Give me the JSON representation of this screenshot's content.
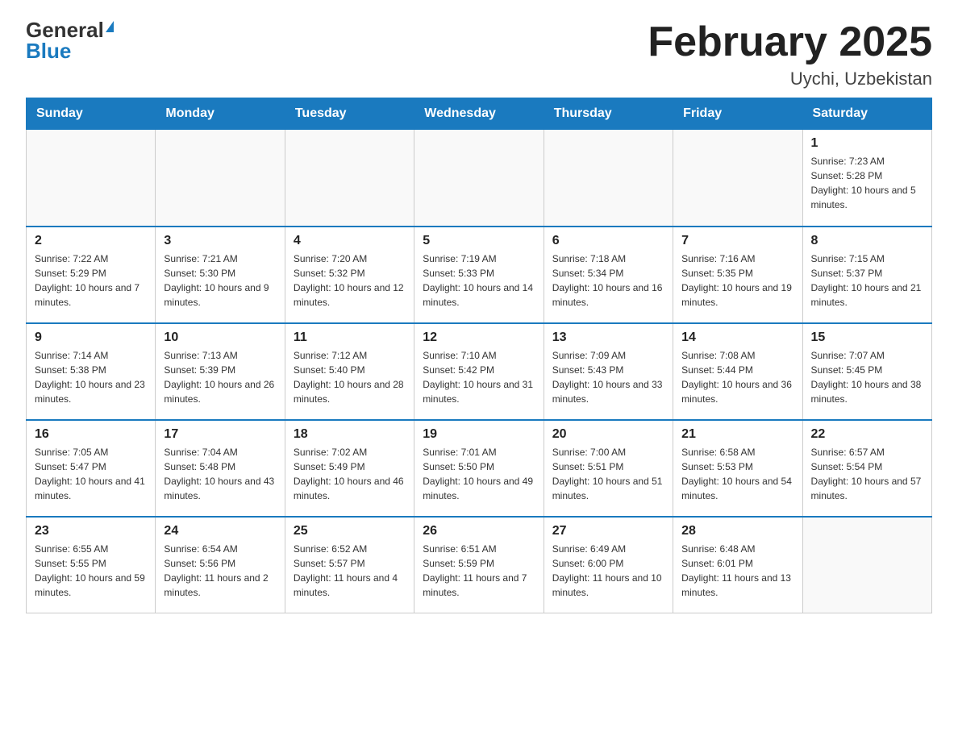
{
  "header": {
    "logo_general": "General",
    "logo_blue": "Blue",
    "month_title": "February 2025",
    "location": "Uychi, Uzbekistan"
  },
  "days_of_week": [
    "Sunday",
    "Monday",
    "Tuesday",
    "Wednesday",
    "Thursday",
    "Friday",
    "Saturday"
  ],
  "weeks": [
    [
      {
        "day": "",
        "sunrise": "",
        "sunset": "",
        "daylight": ""
      },
      {
        "day": "",
        "sunrise": "",
        "sunset": "",
        "daylight": ""
      },
      {
        "day": "",
        "sunrise": "",
        "sunset": "",
        "daylight": ""
      },
      {
        "day": "",
        "sunrise": "",
        "sunset": "",
        "daylight": ""
      },
      {
        "day": "",
        "sunrise": "",
        "sunset": "",
        "daylight": ""
      },
      {
        "day": "",
        "sunrise": "",
        "sunset": "",
        "daylight": ""
      },
      {
        "day": "1",
        "sunrise": "Sunrise: 7:23 AM",
        "sunset": "Sunset: 5:28 PM",
        "daylight": "Daylight: 10 hours and 5 minutes."
      }
    ],
    [
      {
        "day": "2",
        "sunrise": "Sunrise: 7:22 AM",
        "sunset": "Sunset: 5:29 PM",
        "daylight": "Daylight: 10 hours and 7 minutes."
      },
      {
        "day": "3",
        "sunrise": "Sunrise: 7:21 AM",
        "sunset": "Sunset: 5:30 PM",
        "daylight": "Daylight: 10 hours and 9 minutes."
      },
      {
        "day": "4",
        "sunrise": "Sunrise: 7:20 AM",
        "sunset": "Sunset: 5:32 PM",
        "daylight": "Daylight: 10 hours and 12 minutes."
      },
      {
        "day": "5",
        "sunrise": "Sunrise: 7:19 AM",
        "sunset": "Sunset: 5:33 PM",
        "daylight": "Daylight: 10 hours and 14 minutes."
      },
      {
        "day": "6",
        "sunrise": "Sunrise: 7:18 AM",
        "sunset": "Sunset: 5:34 PM",
        "daylight": "Daylight: 10 hours and 16 minutes."
      },
      {
        "day": "7",
        "sunrise": "Sunrise: 7:16 AM",
        "sunset": "Sunset: 5:35 PM",
        "daylight": "Daylight: 10 hours and 19 minutes."
      },
      {
        "day": "8",
        "sunrise": "Sunrise: 7:15 AM",
        "sunset": "Sunset: 5:37 PM",
        "daylight": "Daylight: 10 hours and 21 minutes."
      }
    ],
    [
      {
        "day": "9",
        "sunrise": "Sunrise: 7:14 AM",
        "sunset": "Sunset: 5:38 PM",
        "daylight": "Daylight: 10 hours and 23 minutes."
      },
      {
        "day": "10",
        "sunrise": "Sunrise: 7:13 AM",
        "sunset": "Sunset: 5:39 PM",
        "daylight": "Daylight: 10 hours and 26 minutes."
      },
      {
        "day": "11",
        "sunrise": "Sunrise: 7:12 AM",
        "sunset": "Sunset: 5:40 PM",
        "daylight": "Daylight: 10 hours and 28 minutes."
      },
      {
        "day": "12",
        "sunrise": "Sunrise: 7:10 AM",
        "sunset": "Sunset: 5:42 PM",
        "daylight": "Daylight: 10 hours and 31 minutes."
      },
      {
        "day": "13",
        "sunrise": "Sunrise: 7:09 AM",
        "sunset": "Sunset: 5:43 PM",
        "daylight": "Daylight: 10 hours and 33 minutes."
      },
      {
        "day": "14",
        "sunrise": "Sunrise: 7:08 AM",
        "sunset": "Sunset: 5:44 PM",
        "daylight": "Daylight: 10 hours and 36 minutes."
      },
      {
        "day": "15",
        "sunrise": "Sunrise: 7:07 AM",
        "sunset": "Sunset: 5:45 PM",
        "daylight": "Daylight: 10 hours and 38 minutes."
      }
    ],
    [
      {
        "day": "16",
        "sunrise": "Sunrise: 7:05 AM",
        "sunset": "Sunset: 5:47 PM",
        "daylight": "Daylight: 10 hours and 41 minutes."
      },
      {
        "day": "17",
        "sunrise": "Sunrise: 7:04 AM",
        "sunset": "Sunset: 5:48 PM",
        "daylight": "Daylight: 10 hours and 43 minutes."
      },
      {
        "day": "18",
        "sunrise": "Sunrise: 7:02 AM",
        "sunset": "Sunset: 5:49 PM",
        "daylight": "Daylight: 10 hours and 46 minutes."
      },
      {
        "day": "19",
        "sunrise": "Sunrise: 7:01 AM",
        "sunset": "Sunset: 5:50 PM",
        "daylight": "Daylight: 10 hours and 49 minutes."
      },
      {
        "day": "20",
        "sunrise": "Sunrise: 7:00 AM",
        "sunset": "Sunset: 5:51 PM",
        "daylight": "Daylight: 10 hours and 51 minutes."
      },
      {
        "day": "21",
        "sunrise": "Sunrise: 6:58 AM",
        "sunset": "Sunset: 5:53 PM",
        "daylight": "Daylight: 10 hours and 54 minutes."
      },
      {
        "day": "22",
        "sunrise": "Sunrise: 6:57 AM",
        "sunset": "Sunset: 5:54 PM",
        "daylight": "Daylight: 10 hours and 57 minutes."
      }
    ],
    [
      {
        "day": "23",
        "sunrise": "Sunrise: 6:55 AM",
        "sunset": "Sunset: 5:55 PM",
        "daylight": "Daylight: 10 hours and 59 minutes."
      },
      {
        "day": "24",
        "sunrise": "Sunrise: 6:54 AM",
        "sunset": "Sunset: 5:56 PM",
        "daylight": "Daylight: 11 hours and 2 minutes."
      },
      {
        "day": "25",
        "sunrise": "Sunrise: 6:52 AM",
        "sunset": "Sunset: 5:57 PM",
        "daylight": "Daylight: 11 hours and 4 minutes."
      },
      {
        "day": "26",
        "sunrise": "Sunrise: 6:51 AM",
        "sunset": "Sunset: 5:59 PM",
        "daylight": "Daylight: 11 hours and 7 minutes."
      },
      {
        "day": "27",
        "sunrise": "Sunrise: 6:49 AM",
        "sunset": "Sunset: 6:00 PM",
        "daylight": "Daylight: 11 hours and 10 minutes."
      },
      {
        "day": "28",
        "sunrise": "Sunrise: 6:48 AM",
        "sunset": "Sunset: 6:01 PM",
        "daylight": "Daylight: 11 hours and 13 minutes."
      },
      {
        "day": "",
        "sunrise": "",
        "sunset": "",
        "daylight": ""
      }
    ]
  ]
}
